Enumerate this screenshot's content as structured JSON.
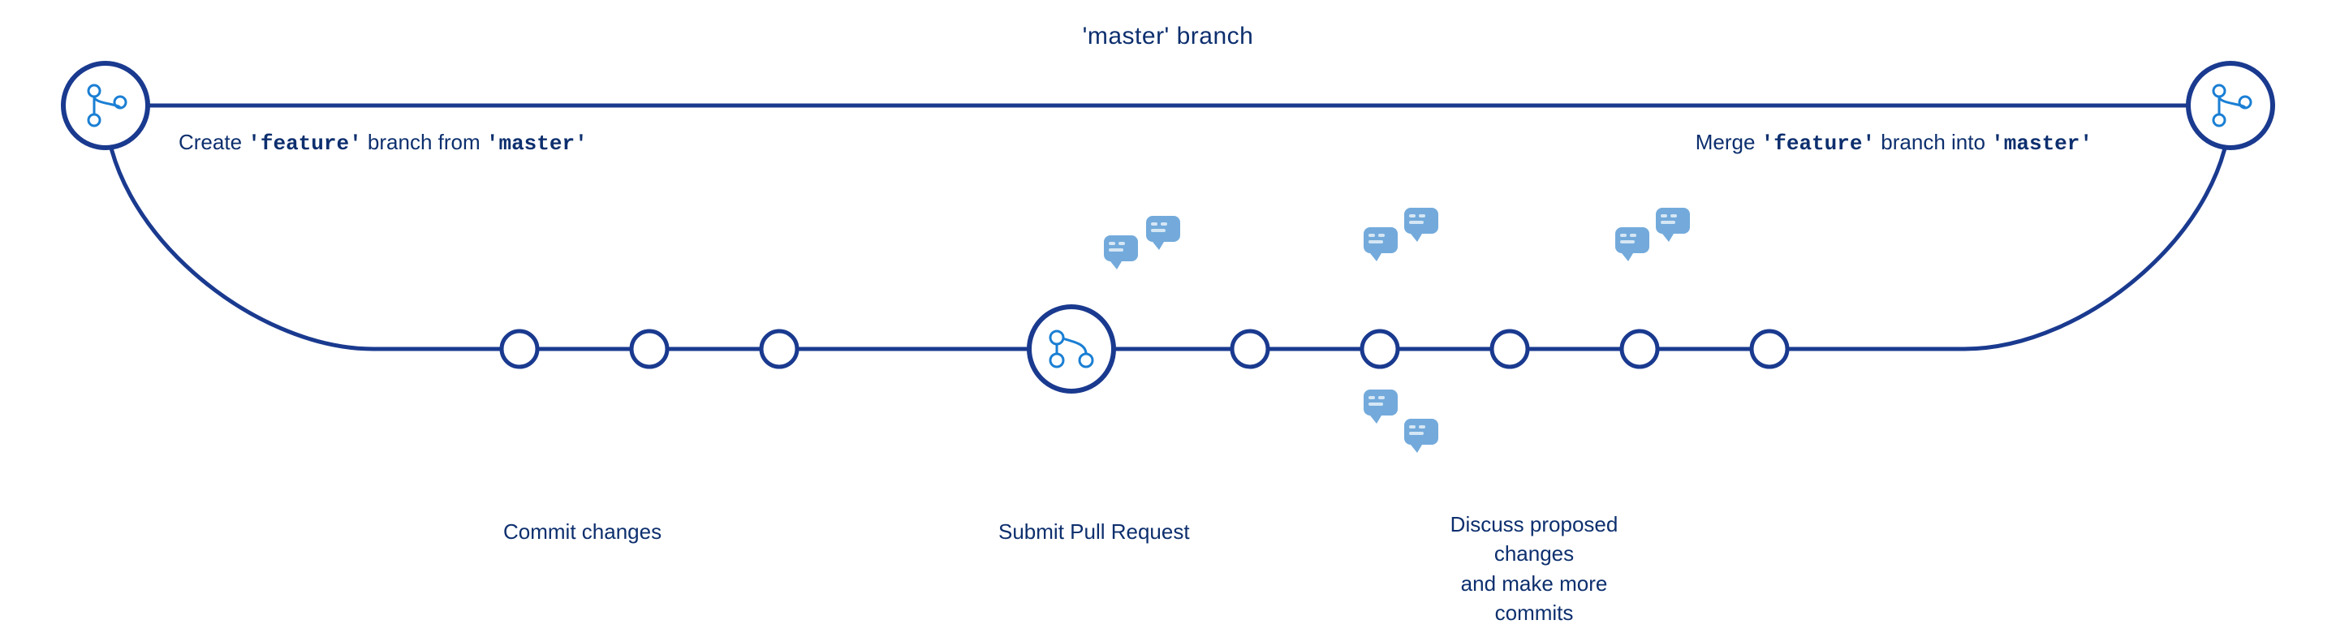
{
  "diagram": {
    "title": "'master' branch",
    "colors": {
      "primary": "#1a3a8f",
      "circle_fill": "#ffffff",
      "circle_stroke": "#1a3a8f",
      "icon_color": "#1a7fd4"
    },
    "labels": {
      "master_branch": "'master' branch",
      "create_branch": "Create 'feature' branch from 'master'",
      "merge_branch": "Merge 'feature' branch into 'master'",
      "commit_changes": "Commit changes",
      "submit_pr": "Submit Pull Request",
      "discuss": "Discuss proposed changes and make more commits"
    }
  }
}
